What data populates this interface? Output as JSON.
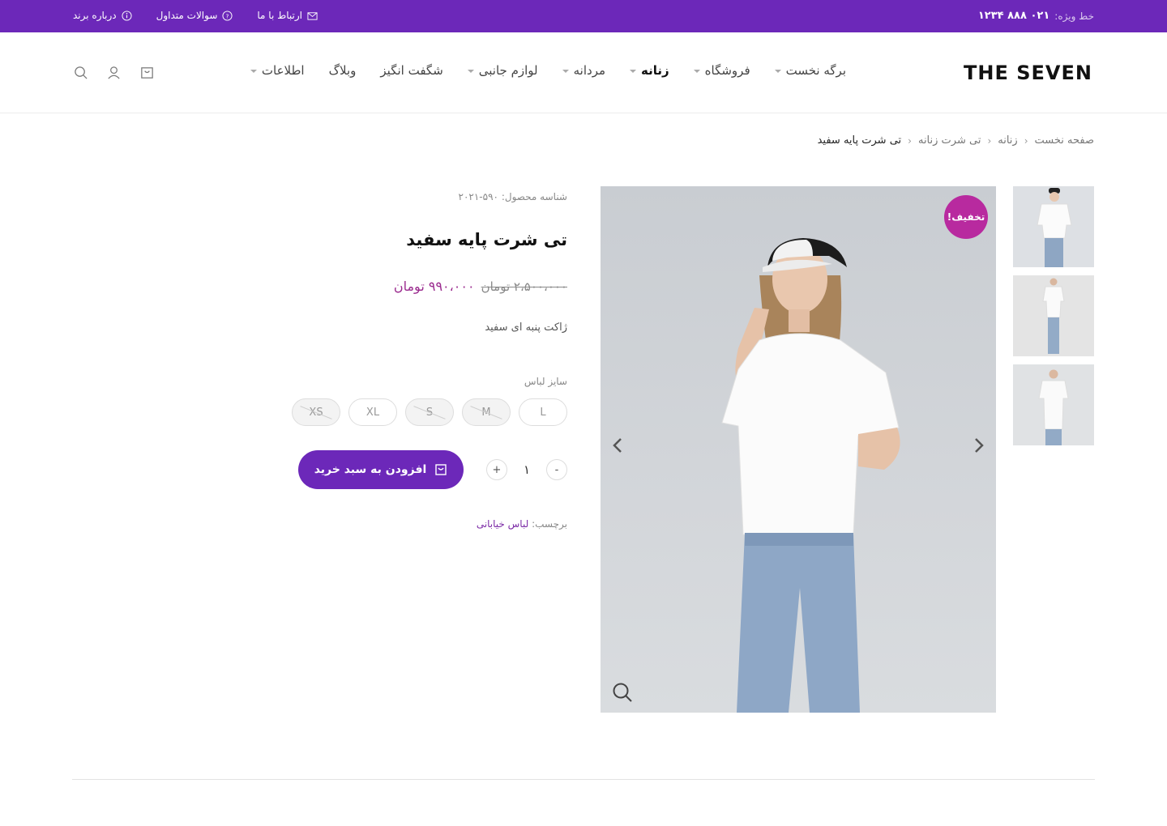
{
  "topbar": {
    "hotline_label": "خط ویژه:",
    "hotline_number": "۰۲۱ ۸۸۸ ۱۲۳۴",
    "links": [
      {
        "label": "درباره برند",
        "icon": "info-icon"
      },
      {
        "label": "سوالات متداول",
        "icon": "help-icon"
      },
      {
        "label": "ارتباط با ما",
        "icon": "mail-icon"
      }
    ]
  },
  "header": {
    "logo": "THE SEVEN",
    "nav": [
      {
        "label": "برگه نخست",
        "dropdown": true,
        "active": false
      },
      {
        "label": "فروشگاه",
        "dropdown": true,
        "active": false
      },
      {
        "label": "زنانه",
        "dropdown": true,
        "active": true
      },
      {
        "label": "مردانه",
        "dropdown": true,
        "active": false
      },
      {
        "label": "لوازم جانبی",
        "dropdown": true,
        "active": false
      },
      {
        "label": "شگفت انگیز",
        "dropdown": false,
        "active": false
      },
      {
        "label": "وبلاگ",
        "dropdown": false,
        "active": false
      },
      {
        "label": "اطلاعات",
        "dropdown": true,
        "active": false
      }
    ],
    "icons": [
      "search-icon",
      "user-icon",
      "cart-icon"
    ]
  },
  "breadcrumb": {
    "items": [
      "صفحه نخست",
      "زنانه",
      "تی شرت زنانه"
    ],
    "current": "تی شرت پایه سفید"
  },
  "gallery": {
    "sale_badge": "تخفیف!",
    "thumbnail_count": 3
  },
  "product": {
    "sku_label": "شناسه محصول:",
    "sku": "۵۹۰-۲۰۲۱",
    "title": "تی شرت پایه سفید",
    "old_price": "۲،۵۰۰،۰۰۰ تومان",
    "new_price": "۹۹۰،۰۰۰ تومان",
    "description": "ژاکت پنبه ای سفید",
    "size_label": "سایز لباس",
    "sizes": [
      {
        "label": "L",
        "available": true
      },
      {
        "label": "M",
        "available": false
      },
      {
        "label": "S",
        "available": false
      },
      {
        "label": "XL",
        "available": true
      },
      {
        "label": "XS",
        "available": false
      }
    ],
    "quantity": "۱",
    "qty_plus": "+",
    "qty_minus": "-",
    "add_to_cart": "افزودن به سبد خرید",
    "tag_label": "برچسب:",
    "tag": "لباس خیابانی"
  },
  "colors": {
    "brand": "#6c28b9",
    "sale": "#b82a9f",
    "price": "#9b2c8f"
  }
}
